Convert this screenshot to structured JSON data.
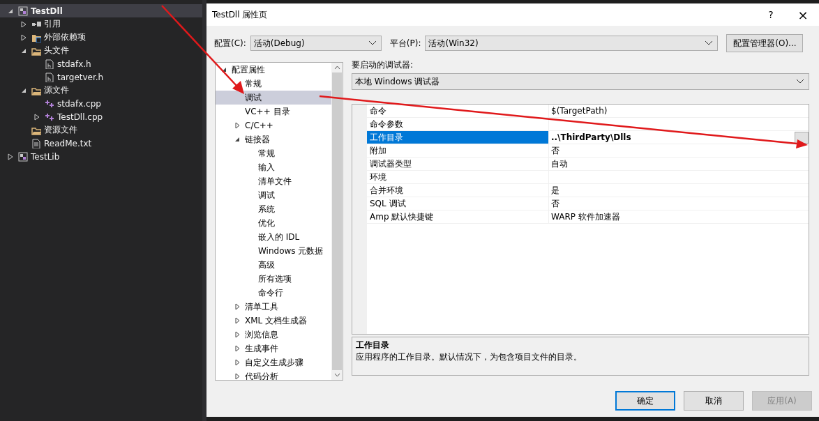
{
  "explorer": {
    "items": [
      {
        "label": "TestDll",
        "kind": "project",
        "expanded": true,
        "selected": true,
        "children": [
          {
            "label": "引用",
            "kind": "references",
            "expanded": false,
            "selected": false
          },
          {
            "label": "外部依赖项",
            "kind": "external",
            "expanded": false,
            "selected": false
          },
          {
            "label": "头文件",
            "kind": "folder",
            "expanded": true,
            "selected": false,
            "children": [
              {
                "label": "stdafx.h",
                "kind": "header",
                "selected": false
              },
              {
                "label": "targetver.h",
                "kind": "header",
                "selected": false
              }
            ]
          },
          {
            "label": "源文件",
            "kind": "folder",
            "expanded": true,
            "selected": false,
            "children": [
              {
                "label": "stdafx.cpp",
                "kind": "cpp",
                "selected": false
              },
              {
                "label": "TestDll.cpp",
                "kind": "cpp",
                "expanded": false,
                "selected": false
              }
            ]
          },
          {
            "label": "资源文件",
            "kind": "folder",
            "selected": false
          },
          {
            "label": "ReadMe.txt",
            "kind": "file",
            "selected": false
          }
        ]
      },
      {
        "label": "TestLib",
        "kind": "project",
        "expanded": false,
        "selected": false
      }
    ]
  },
  "dialog": {
    "title": "TestDll 属性页",
    "help": "?",
    "close": "×",
    "config": {
      "label": "配置(C):",
      "value": "活动(Debug)"
    },
    "platform": {
      "label": "平台(P):",
      "value": "活动(Win32)"
    },
    "manager_button": "配置管理器(O)...",
    "tree": [
      {
        "label": "配置属性",
        "expanded": true,
        "selected": false,
        "children": [
          {
            "label": "常规",
            "selected": false
          },
          {
            "label": "调试",
            "selected": true
          },
          {
            "label": "VC++ 目录",
            "selected": false
          },
          {
            "label": "C/C++",
            "expanded": false,
            "selected": false
          },
          {
            "label": "链接器",
            "expanded": true,
            "selected": false,
            "children": [
              {
                "label": "常规",
                "selected": false
              },
              {
                "label": "输入",
                "selected": false
              },
              {
                "label": "清单文件",
                "selected": false
              },
              {
                "label": "调试",
                "selected": false
              },
              {
                "label": "系统",
                "selected": false
              },
              {
                "label": "优化",
                "selected": false
              },
              {
                "label": "嵌入的 IDL",
                "selected": false
              },
              {
                "label": "Windows 元数据",
                "selected": false
              },
              {
                "label": "高级",
                "selected": false
              },
              {
                "label": "所有选项",
                "selected": false
              },
              {
                "label": "命令行",
                "selected": false
              }
            ]
          },
          {
            "label": "清单工具",
            "expanded": false,
            "selected": false
          },
          {
            "label": "XML 文档生成器",
            "expanded": false,
            "selected": false
          },
          {
            "label": "浏览信息",
            "expanded": false,
            "selected": false
          },
          {
            "label": "生成事件",
            "expanded": false,
            "selected": false
          },
          {
            "label": "自定义生成步骤",
            "expanded": false,
            "selected": false
          },
          {
            "label": "代码分析",
            "expanded": false,
            "selected": false
          }
        ]
      }
    ],
    "debugger_label": "要启动的调试器:",
    "debugger": "本地 Windows 调试器",
    "properties": [
      {
        "name": "命令",
        "value": "$(TargetPath)",
        "selected": false
      },
      {
        "name": "命令参数",
        "selected": false
      },
      {
        "name": "工作目录",
        "value": "..\\ThirdParty\\Dlls",
        "selected": true
      },
      {
        "name": "附加",
        "value": "否",
        "selected": false
      },
      {
        "name": "调试器类型",
        "value": "自动",
        "selected": false
      },
      {
        "name": "环境",
        "selected": false
      },
      {
        "name": "合并环境",
        "value": "是",
        "selected": false
      },
      {
        "name": "SQL 调试",
        "value": "否",
        "selected": false
      },
      {
        "name": "Amp 默认快捷键",
        "value": "WARP 软件加速器",
        "selected": false
      }
    ],
    "description": {
      "title": "工作目录",
      "text": "应用程序的工作目录。默认情况下，为包含项目文件的目录。"
    },
    "buttons": [
      {
        "label": "确定",
        "kind": "default"
      },
      {
        "label": "取消",
        "kind": "normal"
      },
      {
        "label": "应用(A)",
        "kind": "disabled"
      }
    ]
  }
}
